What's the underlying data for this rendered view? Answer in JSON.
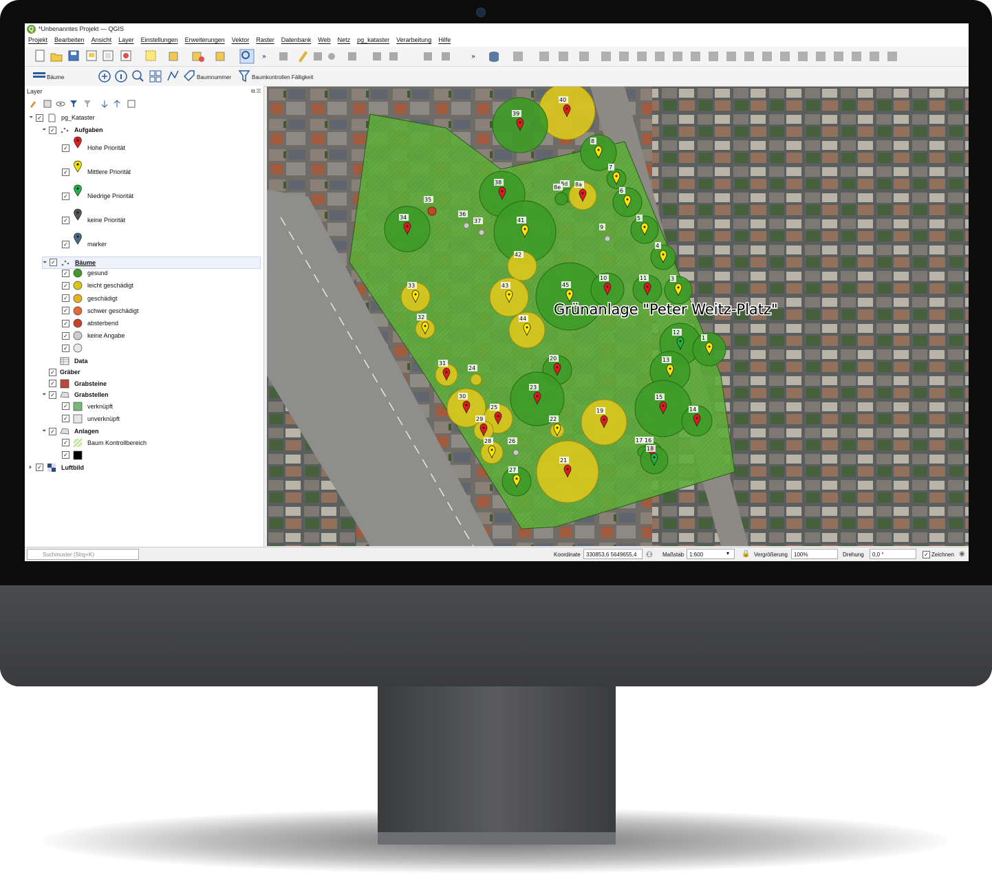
{
  "window": {
    "title": "*Unbenanntes Projekt — QGIS"
  },
  "menu": [
    "Projekt",
    "Bearbeiten",
    "Ansicht",
    "Layer",
    "Einstellungen",
    "Erweiterungen",
    "Vektor",
    "Raster",
    "Datenbank",
    "Web",
    "Netz",
    "pg_kataster",
    "Verarbeitung",
    "Hilfe"
  ],
  "toolbar2": {
    "layer_button": "Bäume",
    "baumnummer": "Baumnummer",
    "filter": "Baumkontrollen Fälligkeit"
  },
  "layer_panel": {
    "title": "Layer",
    "tree": [
      {
        "label": "pg_Kataster",
        "bold": false,
        "indent": 0,
        "expander": "down",
        "symbol": "db"
      },
      {
        "label": "Aufgaben",
        "bold": true,
        "indent": 1,
        "expander": "down",
        "symbol": "points"
      },
      {
        "label": "Hohe Priorität",
        "indent": 2,
        "symbol": "pin",
        "color": "#e02020",
        "tall": true
      },
      {
        "label": "Mittlere Priorität",
        "indent": 2,
        "symbol": "pin",
        "color": "#f2e100",
        "tall": true
      },
      {
        "label": "Niedrige Priorität",
        "indent": 2,
        "symbol": "pin",
        "color": "#22b14c",
        "tall": true
      },
      {
        "label": "keine Priorität",
        "indent": 2,
        "symbol": "pin",
        "color": "#555555",
        "tall": true
      },
      {
        "label": "marker",
        "indent": 2,
        "symbol": "pin",
        "color": "#4a6a8a",
        "tall": true
      },
      {
        "label": "Bäume",
        "bold": true,
        "indent": 1,
        "expander": "down",
        "symbol": "points",
        "selected": true
      },
      {
        "label": "gesund",
        "indent": 2,
        "symbol": "circle",
        "color": "#3e9b28"
      },
      {
        "label": "leicht geschädigt",
        "indent": 2,
        "symbol": "circle",
        "color": "#d8c41a"
      },
      {
        "label": "geschädigt",
        "indent": 2,
        "symbol": "circle",
        "color": "#e8b020"
      },
      {
        "label": "schwer geschädigt",
        "indent": 2,
        "symbol": "circle",
        "color": "#e46a3a"
      },
      {
        "label": "absterbend",
        "indent": 2,
        "symbol": "circle",
        "color": "#c8402a"
      },
      {
        "label": "keine Angabe",
        "indent": 2,
        "symbol": "circle",
        "color": "#cccccc"
      },
      {
        "label": "",
        "indent": 2,
        "symbol": "circle",
        "color": "#e8e8e8"
      },
      {
        "label": "Data",
        "bold": true,
        "indent": 1,
        "symbol": "table",
        "nocheck": true
      },
      {
        "label": "Gräber",
        "bold": true,
        "indent": 1,
        "symbol": "none"
      },
      {
        "label": "Grabsteine",
        "bold": true,
        "indent": 1,
        "symbol": "square",
        "color": "#b84a3a"
      },
      {
        "label": "Grabstellen",
        "bold": true,
        "indent": 1,
        "expander": "down",
        "symbol": "poly"
      },
      {
        "label": "verknüpft",
        "indent": 2,
        "symbol": "square",
        "color": "#7ab87a"
      },
      {
        "label": "unverknüpft",
        "indent": 2,
        "symbol": "square",
        "color": "#e6e6e6"
      },
      {
        "label": "Anlagen",
        "bold": true,
        "indent": 1,
        "expander": "down",
        "symbol": "poly"
      },
      {
        "label": "Baum Kontrollbereich",
        "indent": 2,
        "symbol": "hatch",
        "color": "#9bd06a"
      },
      {
        "label": "",
        "indent": 2,
        "symbol": "square",
        "color": "#000000"
      },
      {
        "label": "Luftbild",
        "bold": true,
        "indent": 0,
        "expander": "right",
        "symbol": "raster"
      }
    ]
  },
  "map": {
    "park_label": "Grünanlage \"Peter Weitz-Platz\"",
    "trees": [
      {
        "id": "40",
        "s": "y",
        "r": 41,
        "pin": "r"
      },
      {
        "id": "39",
        "s": "g",
        "r": 40,
        "pin": "r"
      },
      {
        "id": "8",
        "s": "g",
        "r": 26,
        "pin": "y"
      },
      {
        "id": "7",
        "s": "g",
        "r": 14,
        "pin": "y"
      },
      {
        "id": "38",
        "s": "g",
        "r": 33,
        "pin": "r"
      },
      {
        "id": "8d",
        "s": "g",
        "r": 10,
        "pin": ""
      },
      {
        "id": "8e",
        "s": "g",
        "r": 9,
        "pin": ""
      },
      {
        "id": "8a",
        "s": "y",
        "r": 20,
        "pin": "r"
      },
      {
        "id": "6",
        "s": "g",
        "r": 21,
        "pin": "y"
      },
      {
        "id": "35",
        "s": "r",
        "r": 6,
        "pin": ""
      },
      {
        "id": "34",
        "s": "g",
        "r": 33,
        "pin": "r"
      },
      {
        "id": "36",
        "s": "n",
        "r": 4,
        "pin": ""
      },
      {
        "id": "37",
        "s": "n",
        "r": 4,
        "pin": ""
      },
      {
        "id": "41",
        "s": "g",
        "r": 45,
        "pin": "y"
      },
      {
        "id": "9",
        "s": "n",
        "r": 4,
        "pin": ""
      },
      {
        "id": "5",
        "s": "g",
        "r": 20,
        "pin": "y"
      },
      {
        "id": "42",
        "s": "y",
        "r": 21,
        "pin": ""
      },
      {
        "id": "4",
        "s": "g",
        "r": 18,
        "pin": "y"
      },
      {
        "id": "45",
        "s": "g",
        "r": 49,
        "pin": "y"
      },
      {
        "id": "10",
        "s": "g",
        "r": 24,
        "pin": "r"
      },
      {
        "id": "11",
        "s": "g",
        "r": 21,
        "pin": "r"
      },
      {
        "id": "3",
        "s": "g",
        "r": 20,
        "pin": "y"
      },
      {
        "id": "33",
        "s": "y",
        "r": 21,
        "pin": "y"
      },
      {
        "id": "43",
        "s": "y",
        "r": 28,
        "pin": "y"
      },
      {
        "id": "32",
        "s": "y",
        "r": 14,
        "pin": "y"
      },
      {
        "id": "44",
        "s": "y",
        "r": 26,
        "pin": "y"
      },
      {
        "id": "12",
        "s": "g",
        "r": 30,
        "pin": "gr"
      },
      {
        "id": "1",
        "s": "g",
        "r": 24,
        "pin": "y"
      },
      {
        "id": "20",
        "s": "g",
        "r": 21,
        "pin": "r"
      },
      {
        "id": "13",
        "s": "g",
        "r": 29,
        "pin": "y"
      },
      {
        "id": "31",
        "s": "y",
        "r": 16,
        "pin": "r"
      },
      {
        "id": "24",
        "s": "y",
        "r": 8,
        "pin": ""
      },
      {
        "id": "23",
        "s": "g",
        "r": 39,
        "pin": "r"
      },
      {
        "id": "30",
        "s": "y",
        "r": 28,
        "pin": "r"
      },
      {
        "id": "25",
        "s": "y",
        "r": 21,
        "pin": "r"
      },
      {
        "id": "29",
        "s": "y",
        "r": 14,
        "pin": "r"
      },
      {
        "id": "19",
        "s": "y",
        "r": 33,
        "pin": "r"
      },
      {
        "id": "15",
        "s": "g",
        "r": 41,
        "pin": "r"
      },
      {
        "id": "14",
        "s": "g",
        "r": 22,
        "pin": "r"
      },
      {
        "id": "22",
        "s": "y",
        "r": 10,
        "pin": "y"
      },
      {
        "id": "28",
        "s": "y",
        "r": 16,
        "pin": "y"
      },
      {
        "id": "26",
        "s": "n",
        "r": 4,
        "pin": ""
      },
      {
        "id": "21",
        "s": "y",
        "r": 45,
        "pin": "r"
      },
      {
        "id": "16",
        "s": "g",
        "r": 14,
        "pin": "r"
      },
      {
        "id": "17",
        "s": "g",
        "r": 8,
        "pin": ""
      },
      {
        "id": "18",
        "s": "g",
        "r": 20,
        "pin": "gr"
      },
      {
        "id": "27",
        "s": "g",
        "r": 21,
        "pin": "y"
      }
    ]
  },
  "statusbar": {
    "search_placeholder": "Suchmuster (Strg+K)",
    "coord_label": "Koordinate",
    "coord_value": "330853,6 5649655,4",
    "scale_label": "Maßstab",
    "scale_value": "1:600",
    "zoom_label": "Vergrößerung",
    "zoom_value": "100%",
    "rotation_label": "Drehung",
    "rotation_value": "0,0 °",
    "render_label": "Zeichnen"
  },
  "colors": {
    "healthy": "#3e9b28",
    "damaged": "#d9c51e",
    "pin_red": "#e31a1c",
    "pin_yellow": "#ffe600",
    "pin_green": "#1fb33b",
    "park": "#5fae3a"
  }
}
